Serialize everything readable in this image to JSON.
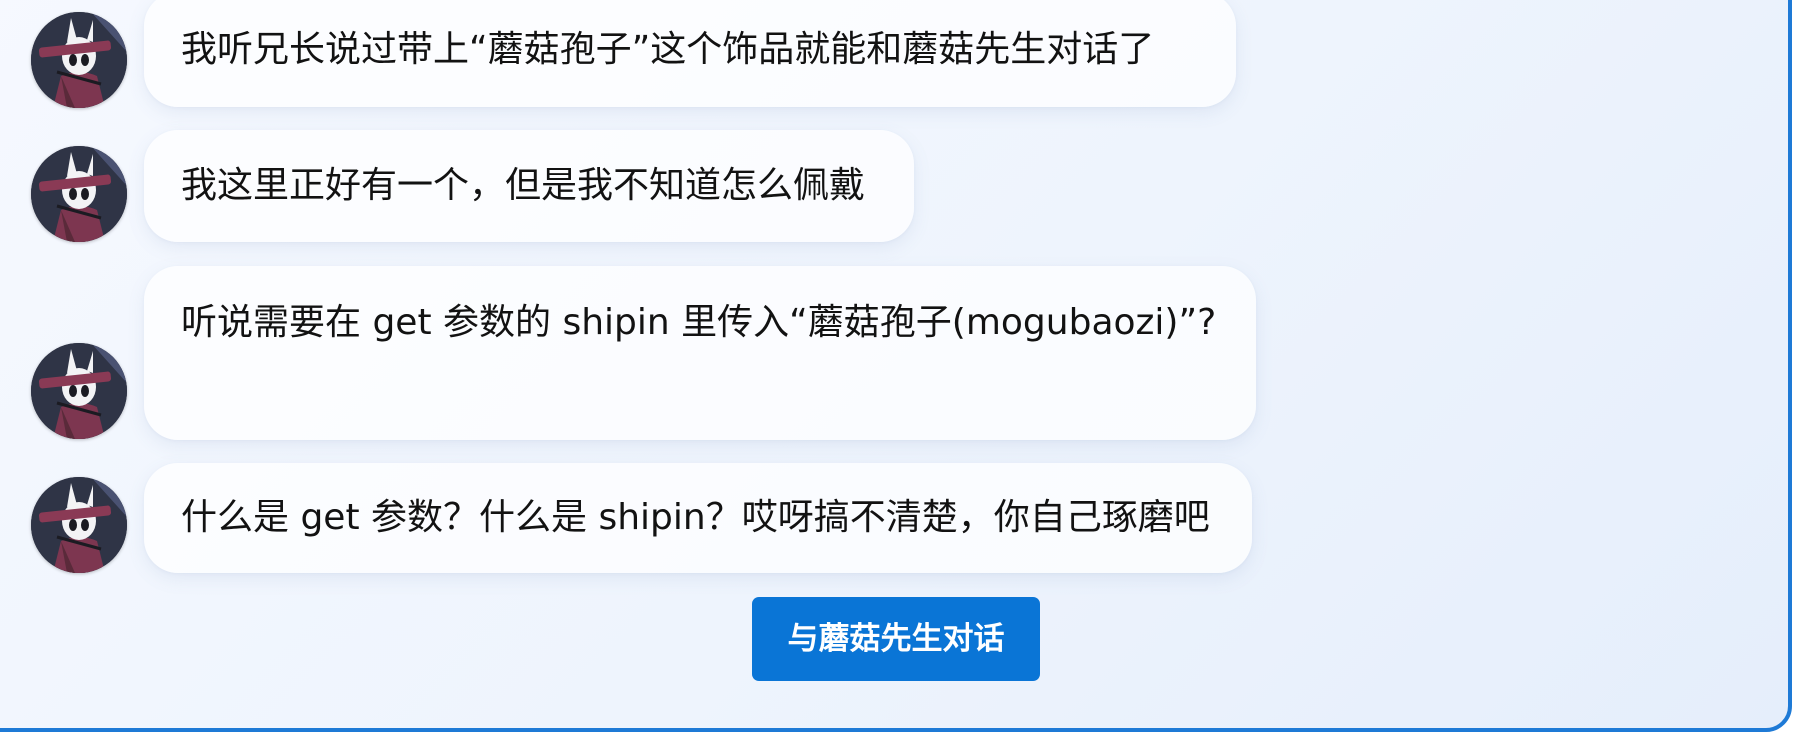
{
  "messages": [
    {
      "avatar_icon": "knight-avatar-icon",
      "text": "我听兄长说过带上“蘑菇孢子”这个饰品就能和蘑菇先生对话了"
    },
    {
      "avatar_icon": "knight-avatar-icon",
      "text": "我这里正好有一个，但是我不知道怎么佩戴"
    },
    {
      "avatar_icon": "knight-avatar-icon",
      "text": "听说需要在 get 参数的 shipin 里传入“蘑菇孢子(mogubaozi)”?"
    },
    {
      "avatar_icon": "knight-avatar-icon",
      "text": "什么是 get 参数？什么是 shipin？哎呀搞不清楚，你自己琢磨吧"
    }
  ],
  "action": {
    "label": "与蘑菇先生对话"
  },
  "colors": {
    "accent": "#0a75d6",
    "border": "#1e7ad6",
    "text": "#121212"
  }
}
